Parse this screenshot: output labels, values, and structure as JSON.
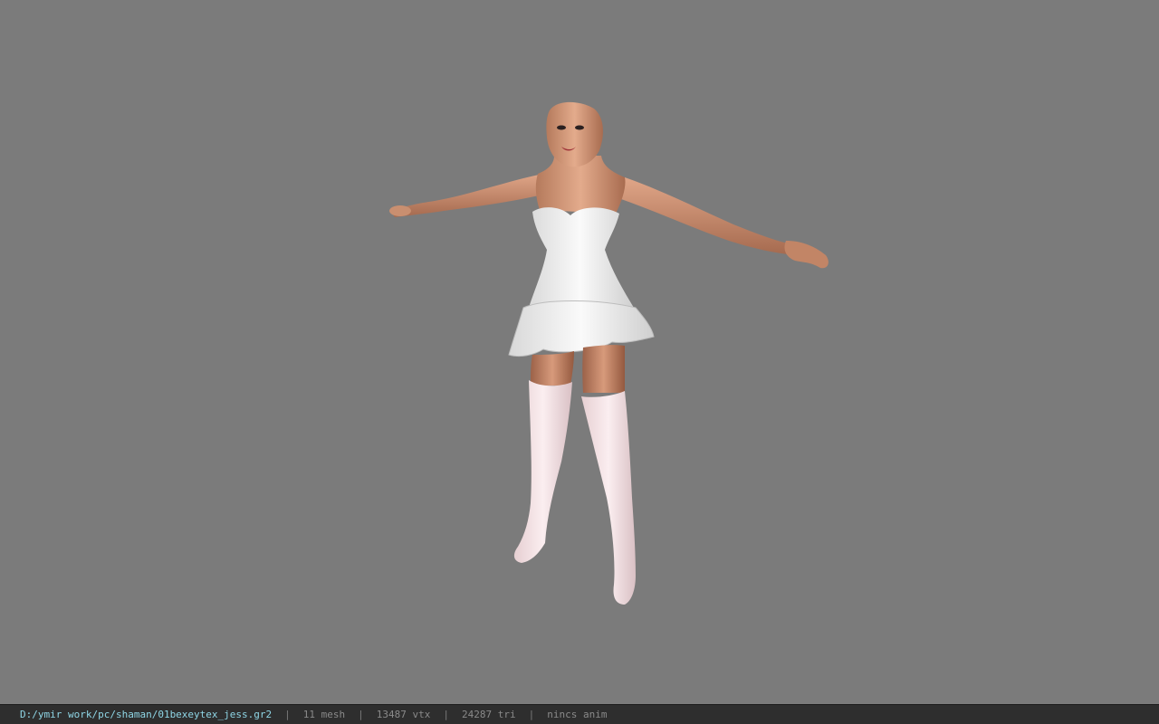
{
  "viewer": {
    "background_color": "#7b7b7b",
    "model_icon": "character-model-3d"
  },
  "statusbar": {
    "file_path": "D:/ymir work/pc/shaman/01bexeytex_jess.gr2",
    "separator": "|",
    "mesh_count": "11 mesh",
    "vertex_count": "13487 vtx",
    "triangle_count": "24287 tri",
    "anim_status": "nincs anim",
    "path_color": "#8fd6e6",
    "bg_color": "#2e2e2e"
  }
}
